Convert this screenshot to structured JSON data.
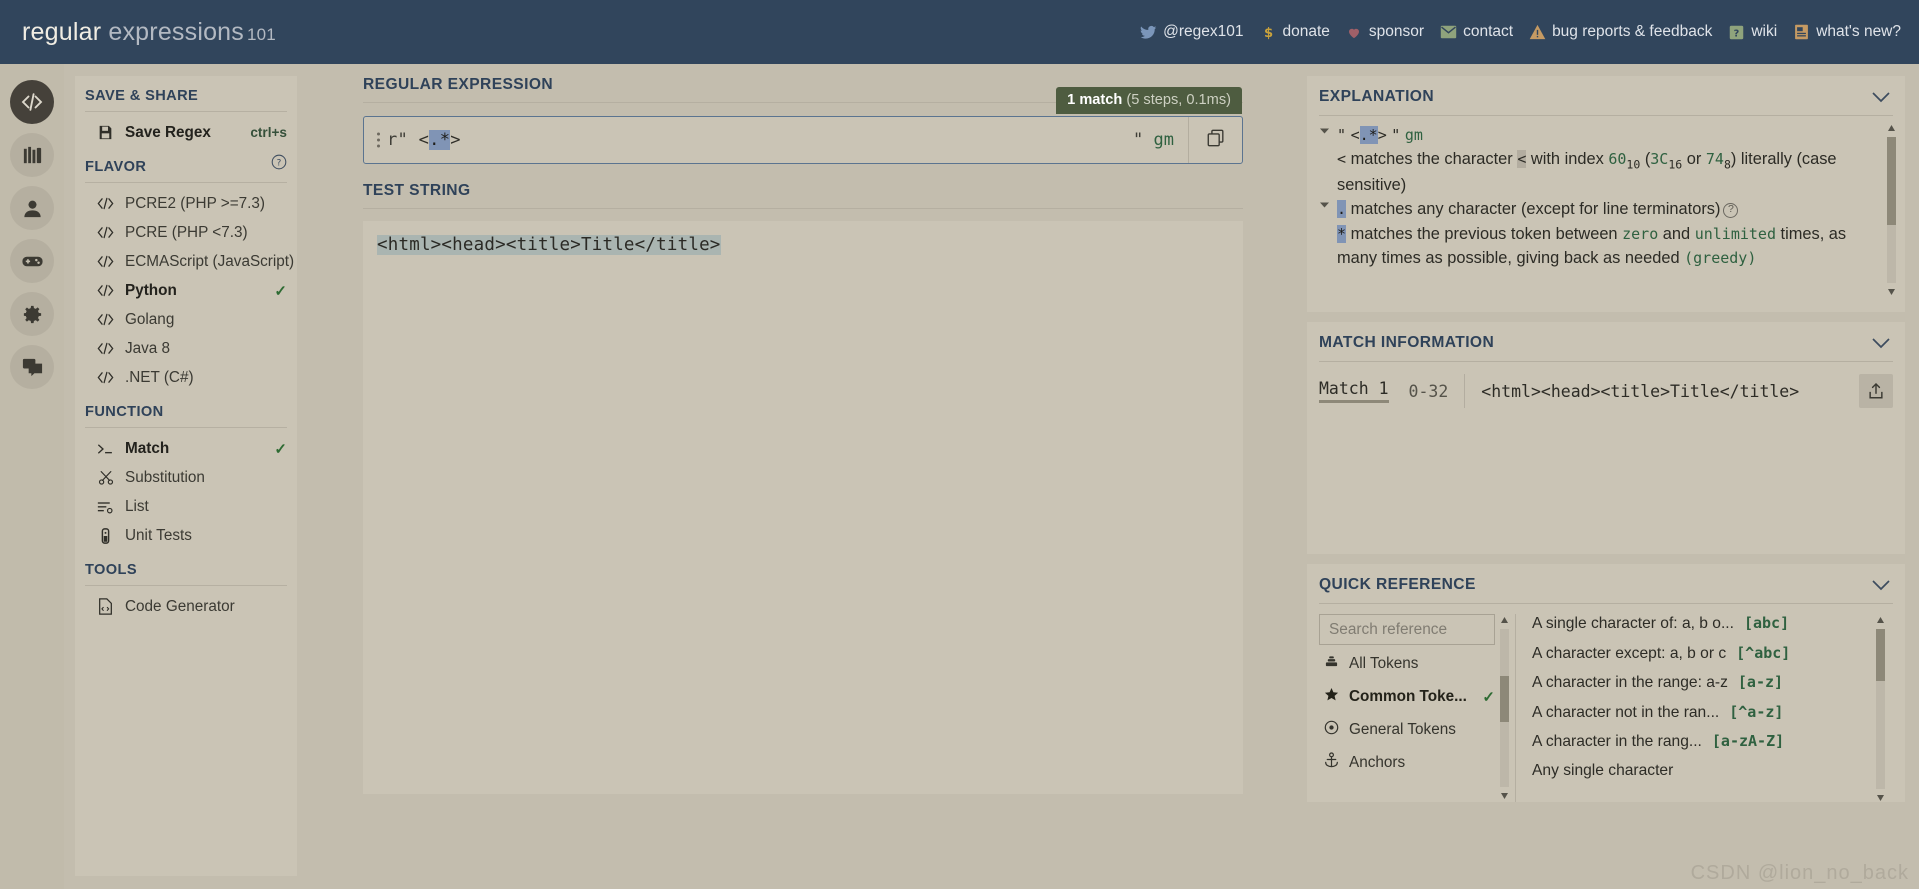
{
  "header": {
    "brand_regular": "regular",
    "brand_expressions": " expressions",
    "brand_101": "101",
    "nav": [
      {
        "label": "@regex101",
        "icon": "twitter-icon"
      },
      {
        "label": "donate",
        "icon": "dollar-icon"
      },
      {
        "label": "sponsor",
        "icon": "heart-icon"
      },
      {
        "label": "contact",
        "icon": "mail-icon"
      },
      {
        "label": "bug reports & feedback",
        "icon": "warning-icon"
      },
      {
        "label": "wiki",
        "icon": "book-icon"
      },
      {
        "label": "what's new?",
        "icon": "news-icon"
      }
    ]
  },
  "rail": [
    {
      "icon": "code-icon",
      "active": true
    },
    {
      "icon": "library-icon",
      "active": false
    },
    {
      "icon": "account-icon",
      "active": false
    },
    {
      "icon": "gamepad-icon",
      "active": false
    },
    {
      "icon": "gear-icon",
      "active": false
    },
    {
      "icon": "chat-icon",
      "active": false
    }
  ],
  "sidebar": {
    "save_share": {
      "title": "SAVE & SHARE",
      "items": [
        {
          "label": "Save Regex",
          "shortcut": "ctrl+s",
          "icon": "save-icon"
        }
      ]
    },
    "flavor": {
      "title": "FLAVOR",
      "help_icon": "help-icon",
      "items": [
        {
          "label": "PCRE2 (PHP >=7.3)",
          "selected": false
        },
        {
          "label": "PCRE (PHP <7.3)",
          "selected": false
        },
        {
          "label": "ECMAScript (JavaScript)",
          "selected": false
        },
        {
          "label": "Python",
          "selected": true
        },
        {
          "label": "Golang",
          "selected": false
        },
        {
          "label": "Java 8",
          "selected": false
        },
        {
          "label": ".NET (C#)",
          "selected": false
        }
      ]
    },
    "function": {
      "title": "FUNCTION",
      "items": [
        {
          "label": "Match",
          "icon": "terminal-icon",
          "selected": true
        },
        {
          "label": "Substitution",
          "icon": "scissors-icon",
          "selected": false
        },
        {
          "label": "List",
          "icon": "list-icon",
          "selected": false
        },
        {
          "label": "Unit Tests",
          "icon": "testtube-icon",
          "selected": false
        }
      ]
    },
    "tools": {
      "title": "TOOLS",
      "items": [
        {
          "label": "Code Generator",
          "icon": "codefile-icon",
          "selected": false
        }
      ]
    }
  },
  "editor": {
    "regex_label": "REGULAR EXPRESSION",
    "match_badge_count": "1 match",
    "match_badge_detail": " (5 steps, 0.1ms)",
    "regex_prefix": "r\"",
    "regex_pre": "<",
    "regex_highlight": ".*",
    "regex_post": ">",
    "flags_quote": "\"",
    "flags": "gm",
    "copy_icon": "copy-icon",
    "options_icon": "more-vertical-icon",
    "test_label": "TEST STRING",
    "test_string": "<html><head><title>Title</title>"
  },
  "explanation": {
    "title": "EXPLANATION",
    "pattern_quote_open": "\"",
    "pattern_pre": "<",
    "pattern_highlight": ".*",
    "pattern_post": ">",
    "pattern_quote_close": "\"",
    "pattern_flags": "gm",
    "line_lt_token": "<",
    "line_lt_a": " matches the character ",
    "line_lt_tok2": "<",
    "line_lt_b": " with index ",
    "line_lt_dec": "60",
    "line_lt_dec_sub": "10",
    "line_lt_c": " (",
    "line_lt_hex": "3C",
    "line_lt_hex_sub": "16",
    "line_lt_d": " or ",
    "line_lt_oct": "74",
    "line_lt_oct_sub": "8",
    "line_lt_e": ") literally (case sensitive)",
    "line_dot_token": ".",
    "line_dot_text": " matches any character (except for line terminators)",
    "line_star_token": "*",
    "line_star_a": " matches the previous token between ",
    "line_star_zero": "zero",
    "line_star_b": " and ",
    "line_star_unlimited": "unlimited",
    "line_star_c": " times, as many times as possible, giving back as needed ",
    "line_star_greedy": "(greedy)"
  },
  "match_information": {
    "title": "MATCH INFORMATION",
    "match_label": "Match 1",
    "match_range": "0-32",
    "match_value": "<html><head><title>Title</title>",
    "share_icon": "share-icon"
  },
  "quick_reference": {
    "title": "QUICK REFERENCE",
    "search_placeholder": "Search reference",
    "search_value": "",
    "categories": [
      {
        "label": "All Tokens",
        "icon": "alltokens-icon",
        "selected": false
      },
      {
        "label": "Common Toke...",
        "icon": "star-icon",
        "selected": true
      },
      {
        "label": "General Tokens",
        "icon": "target-icon",
        "selected": false
      },
      {
        "label": "Anchors",
        "icon": "anchor-icon",
        "selected": false
      }
    ],
    "rows": [
      {
        "desc": "A single character of: a, b o...",
        "token": "[abc]"
      },
      {
        "desc": "A character except: a, b or c",
        "token": "[^abc]"
      },
      {
        "desc": "A character in the range: a-z",
        "token": "[a-z]"
      },
      {
        "desc": "A character not in the ran...",
        "token": "[^a-z]"
      },
      {
        "desc": "A character in the rang...",
        "token": "[a-zA-Z]"
      },
      {
        "desc": "Any single character",
        "token": ""
      }
    ]
  },
  "watermark": "CSDN @lion_no_back",
  "colors": {
    "topbar": "#31455c",
    "page_bg": "#c3bdae",
    "panel_bg": "#cac4b5",
    "accent_green": "#2f6140",
    "highlight_blue": "#8094b5",
    "badge_green": "#4e5c40",
    "heading_navy": "#2f4259"
  }
}
